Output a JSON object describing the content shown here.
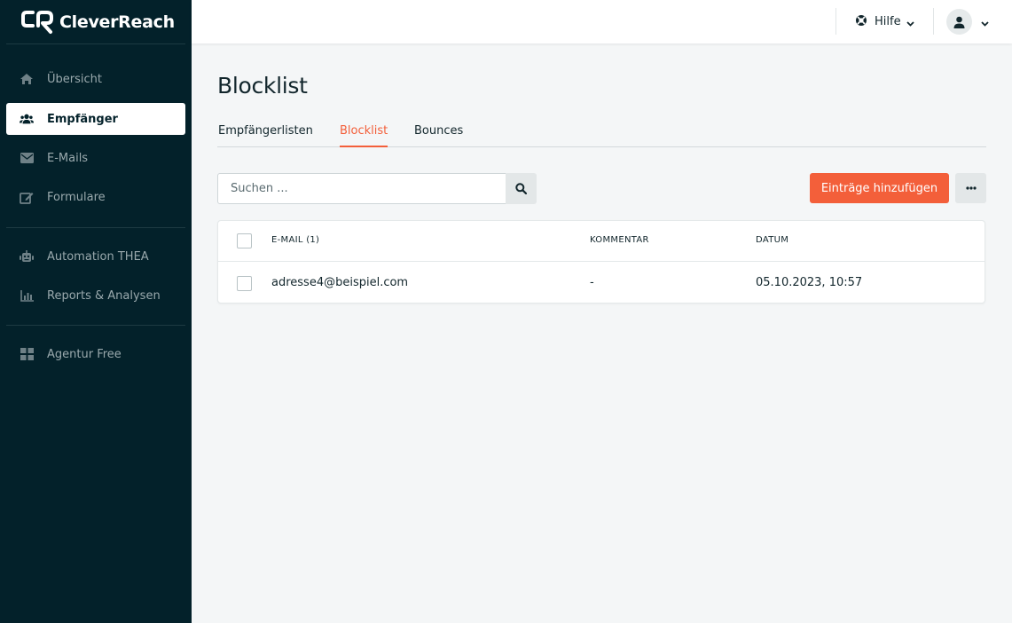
{
  "app": {
    "name": "CleverReach"
  },
  "sidebar": {
    "items": [
      {
        "label": "Übersicht",
        "icon": "home-icon"
      },
      {
        "label": "Empfänger",
        "icon": "users-icon",
        "active": true
      },
      {
        "label": "E-Mails",
        "icon": "envelope-icon"
      },
      {
        "label": "Formulare",
        "icon": "edit-icon"
      },
      {
        "label": "Automation THEA",
        "icon": "robot-icon"
      },
      {
        "label": "Reports & Analysen",
        "icon": "chart-icon"
      },
      {
        "label": "Agentur Free",
        "icon": "grid-icon"
      }
    ]
  },
  "header": {
    "help_label": "Hilfe",
    "help_icon": "lifebuoy-icon",
    "user_icon": "user-icon"
  },
  "page": {
    "title": "Blocklist",
    "tabs": [
      {
        "label": "Empfängerlisten"
      },
      {
        "label": "Blocklist",
        "active": true
      },
      {
        "label": "Bounces"
      }
    ]
  },
  "toolbar": {
    "search_placeholder": "Suchen ...",
    "add_label": "Einträge hinzufügen",
    "more_label": "•••"
  },
  "table": {
    "columns": [
      "E-MAIL (1)",
      "KOMMENTAR",
      "DATUM"
    ],
    "rows": [
      {
        "email": "adresse4@beispiel.com",
        "comment": "-",
        "date": "05.10.2023, 10:57"
      }
    ]
  },
  "colors": {
    "sidebar_bg": "#03212a",
    "accent": "#f35f3a",
    "page_bg": "#f4f6f7"
  }
}
